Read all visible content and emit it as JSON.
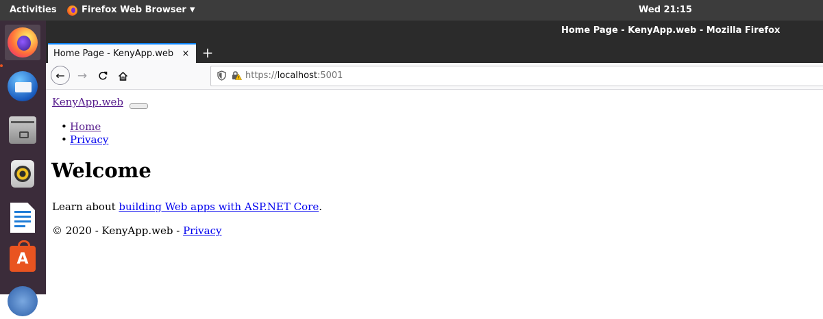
{
  "topbar": {
    "activities": "Activities",
    "app_name": "Firefox Web Browser",
    "clock": "Wed 21:15"
  },
  "dock": {
    "items": [
      "firefox-icon",
      "thunderbird-icon",
      "files-icon",
      "rhythmbox-icon",
      "libreoffice-writer-icon",
      "ubuntu-software-icon",
      "help-icon"
    ]
  },
  "window": {
    "title": "Home Page - KenyApp.web - Mozilla Firefox"
  },
  "tabs": [
    {
      "title": "Home Page - KenyApp.web",
      "close": "×"
    }
  ],
  "newtab_label": "+",
  "toolbar": {
    "back": "←",
    "forward": "→",
    "reload": "C",
    "home": "⌂"
  },
  "urlbar": {
    "scheme": "https://",
    "host": "localhost",
    "port": ":5001"
  },
  "page": {
    "brand": "KenyApp.web",
    "nav": [
      "Home",
      "Privacy"
    ],
    "heading": "Welcome",
    "learn_prefix": "Learn about ",
    "learn_link": "building Web apps with ASP.NET Core",
    "learn_suffix": ".",
    "footer_prefix": "© 2020 - KenyApp.web - ",
    "footer_link": "Privacy"
  },
  "colors": {
    "topbar_bg": "#3c3c3c",
    "dock_bg": "#3b2c3a",
    "link": "#0000ee",
    "visited_link": "#551a8b",
    "tab_accent": "#0a84ff"
  }
}
